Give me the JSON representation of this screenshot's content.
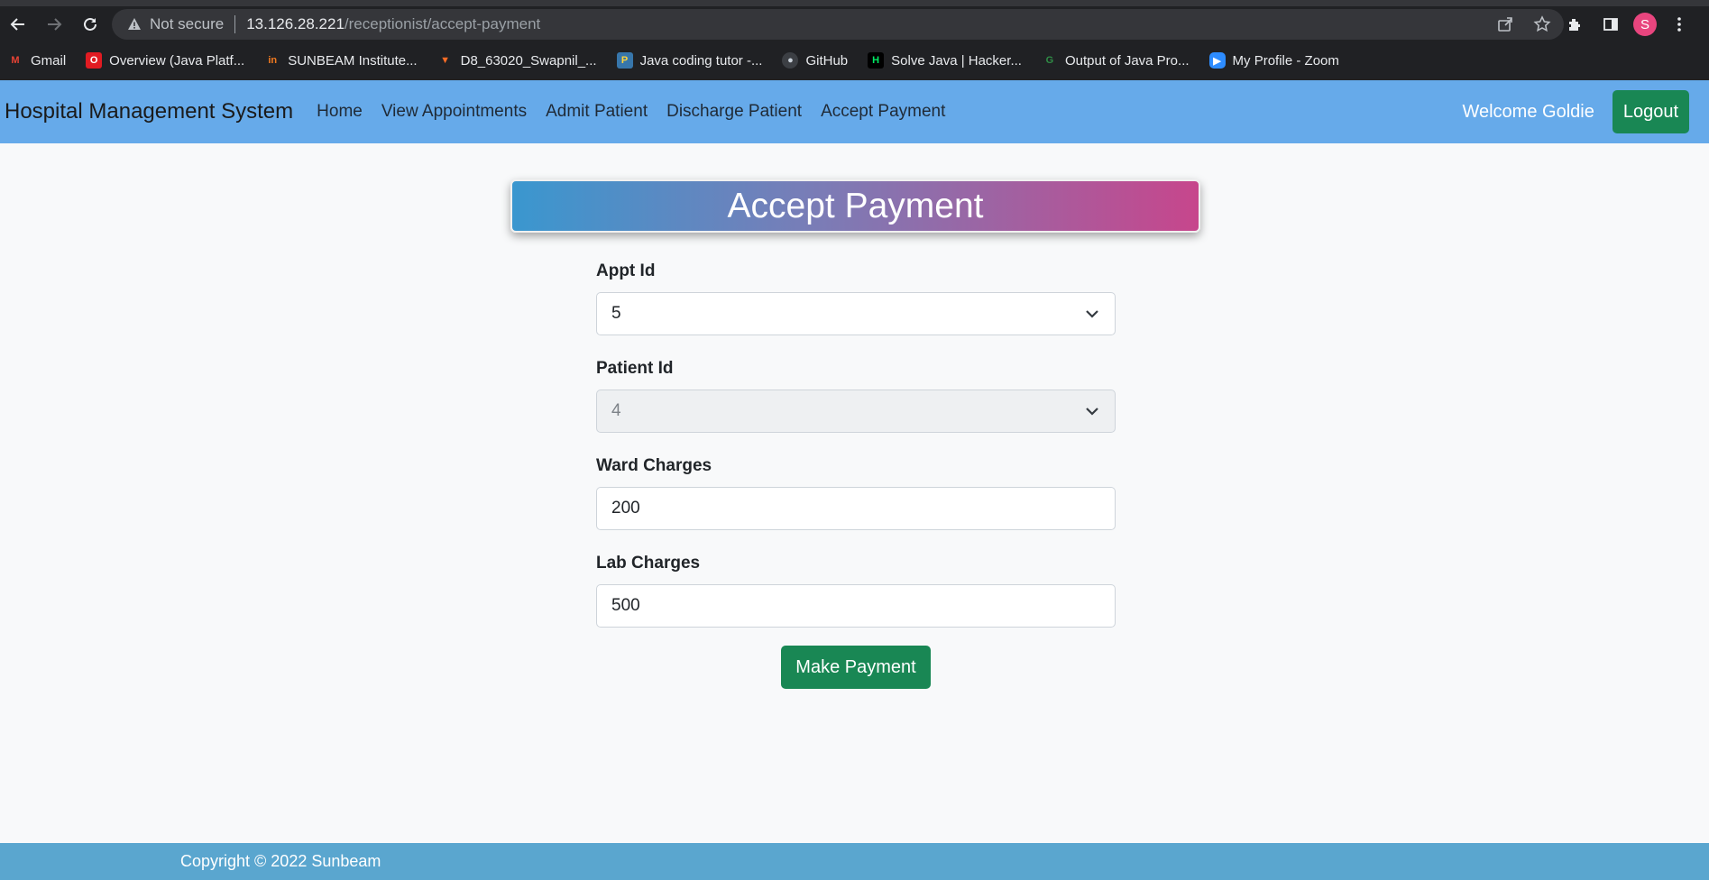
{
  "browser": {
    "security_text": "Not secure",
    "url_host": "13.126.28.221",
    "url_path": "/receptionist/accept-payment",
    "profile_initial": "S",
    "bookmarks": [
      {
        "label": "Gmail",
        "icon": "gmail-icon",
        "color": "#ea4335"
      },
      {
        "label": "Overview (Java Platf...",
        "icon": "oracle-icon",
        "color": "#e11b22"
      },
      {
        "label": "SUNBEAM Institute...",
        "icon": "sunbeam-icon",
        "color": "#f47b20"
      },
      {
        "label": "D8_63020_Swapnil_...",
        "icon": "gitlab-icon",
        "color": "#fc6d26"
      },
      {
        "label": "Java coding tutor -...",
        "icon": "python-icon",
        "color": "#3776ab"
      },
      {
        "label": "GitHub",
        "icon": "github-icon",
        "color": "#8b949e"
      },
      {
        "label": "Solve Java | Hacker...",
        "icon": "hackerrank-icon",
        "color": "#00ea64"
      },
      {
        "label": "Output of Java Pro...",
        "icon": "geeksforgeeks-icon",
        "color": "#2f8d46"
      },
      {
        "label": "My Profile - Zoom",
        "icon": "zoom-icon",
        "color": "#2d8cff"
      }
    ]
  },
  "navbar": {
    "brand": "Hospital Management System",
    "links": [
      "Home",
      "View Appointments",
      "Admit Patient",
      "Discharge Patient",
      "Accept Payment"
    ],
    "welcome": "Welcome Goldie",
    "logout": "Logout"
  },
  "page": {
    "title": "Accept Payment",
    "fields": {
      "appt_id": {
        "label": "Appt Id",
        "value": "5"
      },
      "patient_id": {
        "label": "Patient Id",
        "value": "4"
      },
      "ward_charges": {
        "label": "Ward Charges",
        "value": "200"
      },
      "lab_charges": {
        "label": "Lab Charges",
        "value": "500"
      }
    },
    "submit": "Make Payment"
  },
  "footer": {
    "text": "Copyright © 2022 Sunbeam"
  },
  "colors": {
    "navbar": "#66aaea",
    "button_green": "#198754",
    "footer": "#5aa6cf"
  }
}
